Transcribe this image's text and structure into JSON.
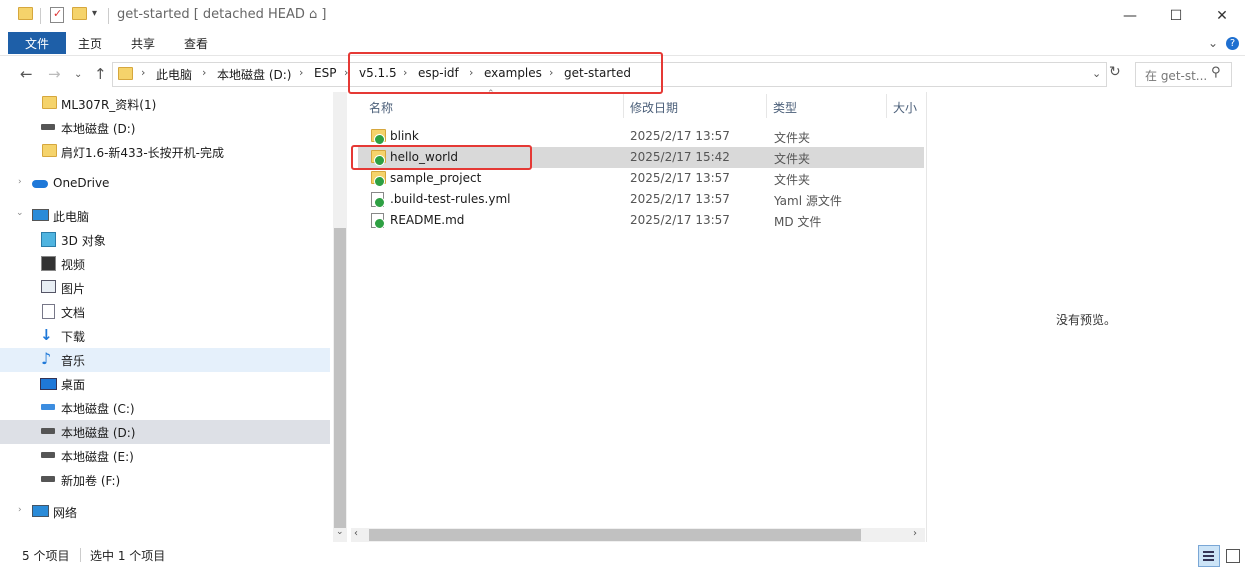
{
  "window": {
    "title": "get-started [ detached HEAD ⌂ ]",
    "minimize": "—",
    "maximize": "☐",
    "close": "✕"
  },
  "ribbon": {
    "file": "文件",
    "tabs": [
      "主页",
      "共享",
      "查看"
    ]
  },
  "address": {
    "crumbs": [
      "此电脑",
      "本地磁盘 (D:)",
      "ESP",
      "v5.1.5",
      "esp-idf",
      "examples",
      "get-started"
    ],
    "search_placeholder": "在 get-st..."
  },
  "nav": {
    "items": [
      {
        "label": "ML307R_资料(1)",
        "icon": "folder-icon"
      },
      {
        "label": "本地磁盘 (D:)",
        "icon": "drive-icon"
      },
      {
        "label": "肩灯1.6-新433-长按开机-完成",
        "icon": "folder-icon"
      },
      {
        "label": "OneDrive",
        "icon": "cloud-icon"
      },
      {
        "label": "此电脑",
        "icon": "pc-icon"
      },
      {
        "label": "3D 对象",
        "icon": "cube-icon"
      },
      {
        "label": "视频",
        "icon": "video-icon"
      },
      {
        "label": "图片",
        "icon": "picture-icon"
      },
      {
        "label": "文档",
        "icon": "document-icon"
      },
      {
        "label": "下载",
        "icon": "download-icon"
      },
      {
        "label": "音乐",
        "icon": "music-icon"
      },
      {
        "label": "桌面",
        "icon": "desktop-icon"
      },
      {
        "label": "本地磁盘 (C:)",
        "icon": "drive-icon"
      },
      {
        "label": "本地磁盘 (D:)",
        "icon": "drive-icon"
      },
      {
        "label": "本地磁盘 (E:)",
        "icon": "drive-icon"
      },
      {
        "label": "新加卷 (F:)",
        "icon": "drive-icon"
      },
      {
        "label": "网络",
        "icon": "network-icon"
      }
    ]
  },
  "columns": {
    "name": "名称",
    "date": "修改日期",
    "type": "类型",
    "size": "大小"
  },
  "files": [
    {
      "name": "blink",
      "date": "2025/2/17 13:57",
      "type": "文件夹",
      "icon": "folder-icon"
    },
    {
      "name": "hello_world",
      "date": "2025/2/17 15:42",
      "type": "文件夹",
      "icon": "folder-icon"
    },
    {
      "name": "sample_project",
      "date": "2025/2/17 13:57",
      "type": "文件夹",
      "icon": "folder-icon"
    },
    {
      "name": ".build-test-rules.yml",
      "date": "2025/2/17 13:57",
      "type": "Yaml 源文件",
      "icon": "file-icon"
    },
    {
      "name": "README.md",
      "date": "2025/2/17 13:57",
      "type": "MD 文件",
      "icon": "file-icon"
    }
  ],
  "preview": {
    "empty_text": "没有预览。"
  },
  "status": {
    "count": "5 个项目",
    "selected": "选中 1 个项目"
  }
}
